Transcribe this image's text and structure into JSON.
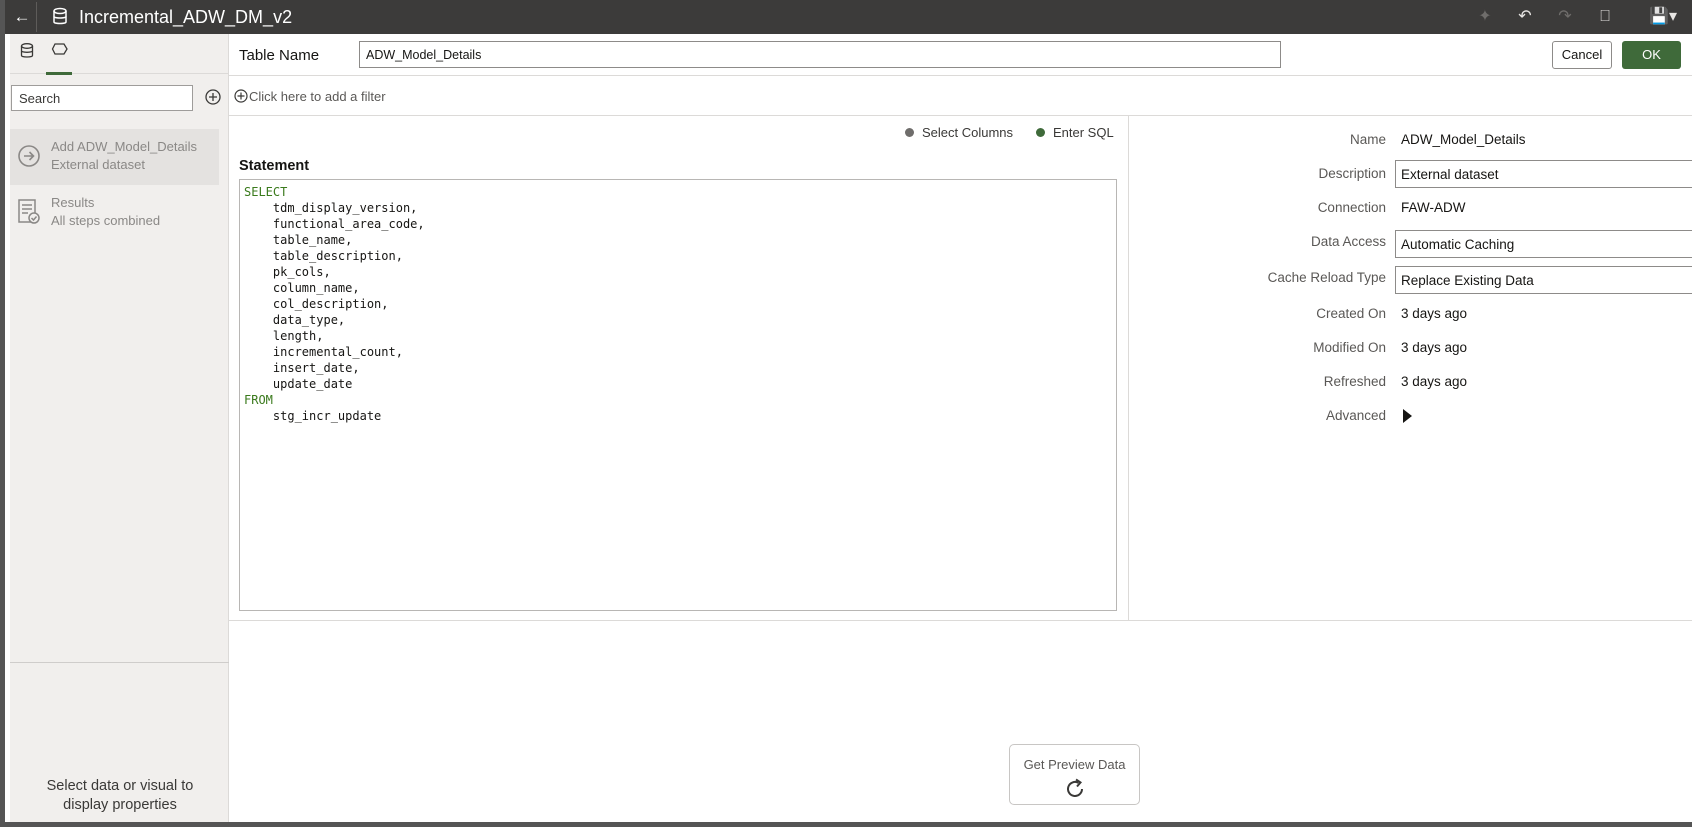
{
  "app": {
    "title": "Incremental_ADW_DM_v2"
  },
  "left_panel": {
    "search_placeholder": "Search",
    "steps": [
      {
        "title": "Add ADW_Model_Details",
        "subtitle": "External dataset"
      },
      {
        "title": "Results",
        "subtitle": "All steps combined"
      }
    ],
    "hint": "Select data or visual to display properties"
  },
  "header": {
    "table_name_label": "Table Name",
    "table_name_value": "ADW_Model_Details",
    "cancel_label": "Cancel",
    "ok_label": "OK"
  },
  "filter": {
    "text": "Click here to add a filter"
  },
  "sql": {
    "mode_options": [
      {
        "label": "Select Columns",
        "color": "#6f6d6b"
      },
      {
        "label": "Enter SQL",
        "color": "#3f6a3a"
      }
    ],
    "statement_label": "Statement",
    "lines": [
      {
        "kw": "SELECT",
        "text": ""
      },
      {
        "kw": "",
        "text": "    tdm_display_version,"
      },
      {
        "kw": "",
        "text": "    functional_area_code,"
      },
      {
        "kw": "",
        "text": "    table_name,"
      },
      {
        "kw": "",
        "text": "    table_description,"
      },
      {
        "kw": "",
        "text": "    pk_cols,"
      },
      {
        "kw": "",
        "text": "    column_name,"
      },
      {
        "kw": "",
        "text": "    col_description,"
      },
      {
        "kw": "",
        "text": "    data_type,"
      },
      {
        "kw": "",
        "text": "    length,"
      },
      {
        "kw": "",
        "text": "    incremental_count,"
      },
      {
        "kw": "",
        "text": "    insert_date,"
      },
      {
        "kw": "",
        "text": "    update_date"
      },
      {
        "kw": "FROM",
        "text": ""
      },
      {
        "kw": "",
        "text": "    stg_incr_update"
      }
    ]
  },
  "properties": {
    "name_label": "Name",
    "name_value": "ADW_Model_Details",
    "description_label": "Description",
    "description_value": "External dataset",
    "connection_label": "Connection",
    "connection_value": "FAW-ADW",
    "data_access_label": "Data Access",
    "data_access_value": "Automatic Caching",
    "cache_reload_label": "Cache Reload Type",
    "cache_reload_value": "Replace Existing Data",
    "created_label": "Created On",
    "created_value": "3 days ago",
    "modified_label": "Modified On",
    "modified_value": "3 days ago",
    "refreshed_label": "Refreshed",
    "refreshed_value": "3 days ago",
    "advanced_label": "Advanced"
  },
  "preview": {
    "label": "Get Preview Data"
  },
  "colors": {
    "accent": "#3f6a3a",
    "titlebar": "#3c3b3a",
    "sql_keyword": "#3a7a1c"
  }
}
